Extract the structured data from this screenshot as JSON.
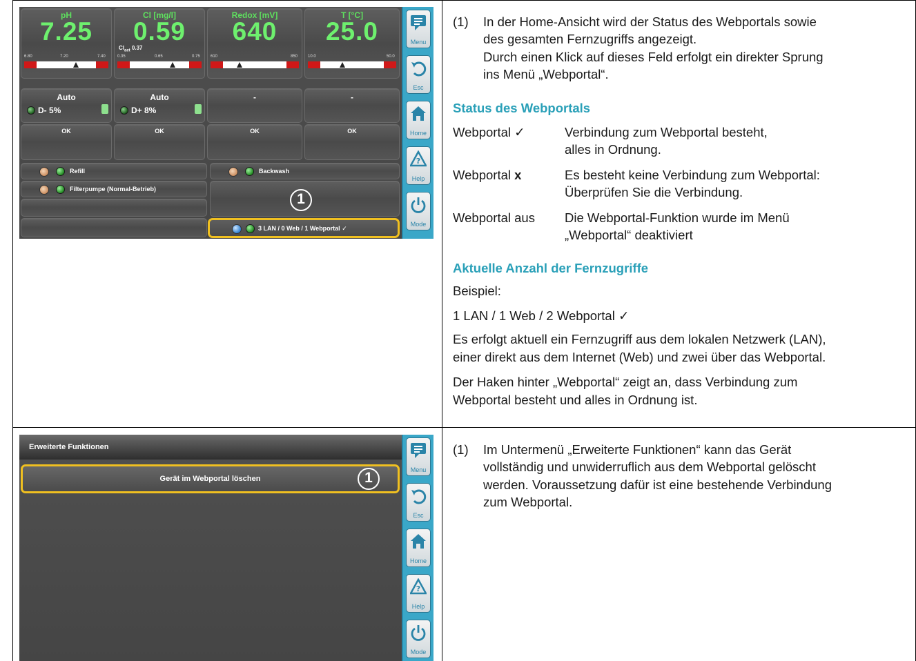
{
  "screen1": {
    "measurements": [
      {
        "label": "pH",
        "value": "7.25",
        "ticks": [
          "6.80",
          "7.20",
          "7.40"
        ]
      },
      {
        "label": "Cl [mg/l]",
        "value": "0.59",
        "ticks": [
          "0.35",
          "0.65",
          "0.75"
        ],
        "sub": "Cl",
        "sub_index": "act",
        "sub_value": "0.37"
      },
      {
        "label": "Redox [mV]",
        "value": "640",
        "ticks": [
          "610",
          "850"
        ]
      },
      {
        "label": "T [°C]",
        "value": "25.0",
        "ticks": [
          "10.0",
          "50.0"
        ]
      }
    ],
    "modes": [
      {
        "mode": "Auto",
        "dosing": "D- 5%"
      },
      {
        "mode": "Auto",
        "dosing": "D+ 8%"
      },
      {
        "mode": "-"
      },
      {
        "mode": "-"
      }
    ],
    "status": [
      "OK",
      "OK",
      "OK",
      "OK"
    ],
    "refill": "Refill",
    "backwash": "Backwash",
    "filterpumpe": "Filterpumpe (Normal-Betrieb)",
    "webportal_status": "3 LAN / 0 Web / 1 Webportal ✓",
    "callout": "1"
  },
  "screen2": {
    "title": "Erweiterte Funktionen",
    "button": "Gerät im Webportal löschen",
    "callout": "1"
  },
  "sidebar": {
    "menu": "Menu",
    "esc": "Esc",
    "home": "Home",
    "help": "Help",
    "mode": "Mode"
  },
  "text1": {
    "num": "(1)",
    "intro1": "In der Home-Ansicht wird der Status des Webportals sowie",
    "intro2": "des gesamten Fernzugriffs angezeigt.",
    "intro3": "Durch einen Klick auf dieses Feld erfolgt ein direkter Sprung",
    "intro4": "ins Menü „Webportal“.",
    "heading1": "Status des Webportals",
    "rows": [
      {
        "term": "Webportal ✓",
        "d1": "Verbindung zum Webportal besteht,",
        "d2": "alles in Ordnung."
      },
      {
        "term": "Webportal ",
        "term_bold": "x",
        "d1": "Es besteht keine Verbindung zum Webportal:",
        "d2": "Überprüfen Sie die Verbindung."
      },
      {
        "term": "Webportal aus",
        "d1": "Die Webportal-Funktion wurde im Menü",
        "d2": "„Webportal“ deaktiviert"
      }
    ],
    "heading2": "Aktuelle Anzahl der Fernzugriffe",
    "beispiel": "Beispiel:",
    "example": "1 LAN / 1 Web / 2 Webportal ✓",
    "p1a": "Es erfolgt aktuell ein Fernzugriff aus dem lokalen Netzwerk (LAN),",
    "p1b": "einer direkt aus dem Internet (Web) und zwei über das Webportal.",
    "p2a": "Der Haken hinter „Webportal“ zeigt an, dass Verbindung zum",
    "p2b": "Webportal besteht und alles in Ordnung ist."
  },
  "text2": {
    "num": "(1)",
    "l1": "Im Untermenü „Erweiterte Funktionen“ kann das Gerät",
    "l2": "vollständig und unwiderruflich aus dem Webportal gelöscht",
    "l3": "werden. Voraussetzung dafür ist eine bestehende Verbindung",
    "l4": "zum Webportal."
  }
}
